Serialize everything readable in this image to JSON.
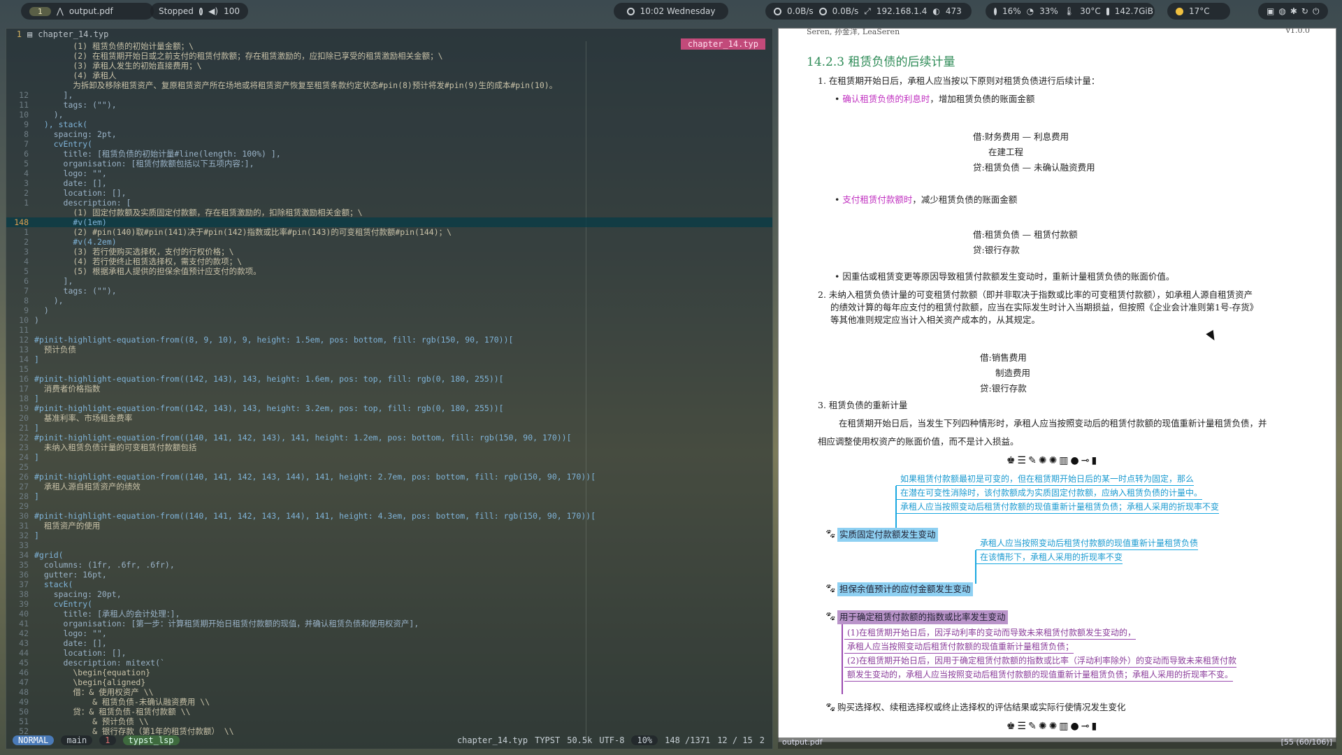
{
  "topbar": {
    "workspace": "1",
    "window_title": "output.pdf",
    "player_status": "Stopped",
    "volume": "100",
    "clock": "10:02 Wednesday",
    "net_down": "0.0B/s",
    "net_up": "0.0B/s",
    "ip": "192.168.1.4",
    "count": "473",
    "cpu": "16%",
    "mem": "33%",
    "temp": "30°C",
    "disk": "142.7GiB",
    "weather": "17°C"
  },
  "editor": {
    "filename": "chapter_14.typ",
    "header_line": "1",
    "tab_label": "chapter_14.typ",
    "lines": [
      {
        "n": "",
        "t": "        (1) 租赁负债的初始计量金额；\\",
        "c": "cmt"
      },
      {
        "n": "",
        "t": "        (2) 在租赁期开始日或之前支付的租赁付款额；存在租赁激励的，应扣除已享受的租赁激励相关金额；\\",
        "c": "cmt"
      },
      {
        "n": "",
        "t": "        (3) 承租人发生的初始直接费用；\\",
        "c": "cmt"
      },
      {
        "n": "",
        "t": "        (4) 承租人",
        "c": "cmt"
      },
      {
        "n": "",
        "t": "        为拆卸及移除租赁资产、复原租赁资产所在场地或将租赁资产恢复至租赁条款约定状态#pin(8)预计将发#pin(9)生的成本#pin(10)。",
        "c": "cmt"
      },
      {
        "n": "12",
        "t": "      ],",
        "c": "key"
      },
      {
        "n": "11",
        "t": "      tags: (\"\"),",
        "c": "key"
      },
      {
        "n": "10",
        "t": "    ),",
        "c": "key"
      },
      {
        "n": "9",
        "t": "  ), stack(",
        "c": "fn"
      },
      {
        "n": "8",
        "t": "    spacing: 2pt,",
        "c": "key"
      },
      {
        "n": "7",
        "t": "    cvEntry(",
        "c": "fn"
      },
      {
        "n": "6",
        "t": "      title: [租赁负债的初始计量#line(length: 100%) ],",
        "c": "key"
      },
      {
        "n": "5",
        "t": "      organisation: [租赁付款额包括以下五项内容：],",
        "c": "key"
      },
      {
        "n": "4",
        "t": "      logo: \"\",",
        "c": "key"
      },
      {
        "n": "3",
        "t": "      date: [],",
        "c": "key"
      },
      {
        "n": "2",
        "t": "      location: [],",
        "c": "key"
      },
      {
        "n": "1",
        "t": "      description: [",
        "c": "key"
      },
      {
        "n": "",
        "t": "        (1) 固定付款额及实质固定付款额，存在租赁激励的，扣除租赁激励相关金额；\\",
        "c": "cmt"
      },
      {
        "n": "148",
        "t": "        #v(1em)",
        "c": "fn",
        "cur": true
      },
      {
        "n": "1",
        "t": "        (2) #pin(140)取#pin(141)决于#pin(142)指数或比率#pin(143)的可变租赁付款额#pin(144)；\\",
        "c": "cmt"
      },
      {
        "n": "2",
        "t": "        #v(4.2em)",
        "c": "fn"
      },
      {
        "n": "3",
        "t": "        (3) 若行使购买选择权，支付的行权价格；\\",
        "c": "cmt"
      },
      {
        "n": "4",
        "t": "        (4) 若行使终止租赁选择权，需支付的款项；\\",
        "c": "cmt"
      },
      {
        "n": "5",
        "t": "        (5) 根据承租人提供的担保余值预计应支付的款项。",
        "c": "cmt"
      },
      {
        "n": "6",
        "t": "      ],",
        "c": "key"
      },
      {
        "n": "7",
        "t": "      tags: (\"\"),",
        "c": "key"
      },
      {
        "n": "8",
        "t": "    ),",
        "c": "key"
      },
      {
        "n": "9",
        "t": "  )",
        "c": "key"
      },
      {
        "n": "10",
        "t": ")",
        "c": "key"
      },
      {
        "n": "11",
        "t": "",
        "c": "key"
      },
      {
        "n": "12",
        "t": "#pinit-highlight-equation-from((8, 9, 10), 9, height: 1.5em, pos: bottom, fill: rgb(150, 90, 170))[",
        "c": "hl"
      },
      {
        "n": "13",
        "t": "  预计负债",
        "c": "cmt"
      },
      {
        "n": "14",
        "t": "]",
        "c": "hl"
      },
      {
        "n": "15",
        "t": "",
        "c": "key"
      },
      {
        "n": "16",
        "t": "#pinit-highlight-equation-from((142, 143), 143, height: 1.6em, pos: top, fill: rgb(0, 180, 255))[",
        "c": "hl"
      },
      {
        "n": "17",
        "t": "  消费者价格指数",
        "c": "cmt"
      },
      {
        "n": "18",
        "t": "]",
        "c": "hl"
      },
      {
        "n": "19",
        "t": "#pinit-highlight-equation-from((142, 143), 143, height: 3.2em, pos: top, fill: rgb(0, 180, 255))[",
        "c": "hl"
      },
      {
        "n": "20",
        "t": "  基准利率、市场租金费率",
        "c": "cmt"
      },
      {
        "n": "21",
        "t": "]",
        "c": "hl"
      },
      {
        "n": "22",
        "t": "#pinit-highlight-equation-from((140, 141, 142, 143), 141, height: 1.2em, pos: bottom, fill: rgb(150, 90, 170))[",
        "c": "hl"
      },
      {
        "n": "23",
        "t": "  未纳入租赁负债计量的可变租赁付款额包括",
        "c": "cmt"
      },
      {
        "n": "24",
        "t": "]",
        "c": "hl"
      },
      {
        "n": "25",
        "t": "",
        "c": "key"
      },
      {
        "n": "26",
        "t": "#pinit-highlight-equation-from((140, 141, 142, 143, 144), 141, height: 2.7em, pos: bottom, fill: rgb(150, 90, 170))[",
        "c": "hl"
      },
      {
        "n": "27",
        "t": "  承租人源自租赁资产的绩效",
        "c": "cmt"
      },
      {
        "n": "28",
        "t": "]",
        "c": "hl"
      },
      {
        "n": "29",
        "t": "",
        "c": "key"
      },
      {
        "n": "30",
        "t": "#pinit-highlight-equation-from((140, 141, 142, 143, 144), 141, height: 4.3em, pos: bottom, fill: rgb(150, 90, 170))[",
        "c": "hl"
      },
      {
        "n": "31",
        "t": "  租赁资产的使用",
        "c": "cmt"
      },
      {
        "n": "32",
        "t": "]",
        "c": "hl"
      },
      {
        "n": "33",
        "t": "",
        "c": "key"
      },
      {
        "n": "34",
        "t": "#grid(",
        "c": "fn"
      },
      {
        "n": "35",
        "t": "  columns: (1fr, .6fr, .6fr),",
        "c": "key"
      },
      {
        "n": "36",
        "t": "  gutter: 16pt,",
        "c": "key"
      },
      {
        "n": "37",
        "t": "  stack(",
        "c": "fn"
      },
      {
        "n": "38",
        "t": "    spacing: 20pt,",
        "c": "key"
      },
      {
        "n": "39",
        "t": "    cvEntry(",
        "c": "fn"
      },
      {
        "n": "40",
        "t": "      title: [承租人的会计处理：],",
        "c": "key"
      },
      {
        "n": "41",
        "t": "      organisation: [第一步：计算租赁期开始日租赁付款额的现值，并确认租赁负债和使用权资产],",
        "c": "key"
      },
      {
        "n": "42",
        "t": "      logo: \"\",",
        "c": "key"
      },
      {
        "n": "43",
        "t": "      date: [],",
        "c": "key"
      },
      {
        "n": "44",
        "t": "      location: [],",
        "c": "key"
      },
      {
        "n": "45",
        "t": "      description: mitext(`",
        "c": "key"
      },
      {
        "n": "46",
        "t": "        \\begin{equation}",
        "c": "cmt"
      },
      {
        "n": "47",
        "t": "        \\begin{aligned}",
        "c": "cmt"
      },
      {
        "n": "48",
        "t": "        借：& 使用权资产 \\\\",
        "c": "cmt"
      },
      {
        "n": "49",
        "t": "            & 租赁负债-未确认融资费用 \\\\",
        "c": "cmt"
      },
      {
        "n": "50",
        "t": "        贷：& 租赁负债-租赁付款额 \\\\",
        "c": "cmt"
      },
      {
        "n": "51",
        "t": "            & 预计负债 \\\\",
        "c": "cmt"
      },
      {
        "n": "52",
        "t": "            & 银行存款（第1年的租赁付款额） \\\\",
        "c": "cmt"
      }
    ]
  },
  "statusline": {
    "mode": "NORMAL",
    "branch": "main",
    "errors": "1",
    "lsp": "typst_lsp",
    "file": "chapter_14.typ",
    "filetype": "TYPST",
    "size": "50.5k",
    "encoding": "UTF-8",
    "percent": "10%",
    "position": "148 /1371",
    "column": "12 / 15",
    "buffers": "2"
  },
  "pdf": {
    "author": "Seren, 孙金洋, LeaSeren",
    "version": "v1.0.0",
    "section_title": "14.2.3 租赁负债的后续计量",
    "p1": "1.  在租赁期开始日后，承租人应当按以下原则对租赁负债进行后续计量：",
    "b1_hl": "确认租赁负债的利息时",
    "b1_rest": "，增加租赁负债的账面金额",
    "j1a": "借:财务费用 — 利息费用",
    "j1b": "在建工程",
    "j1c": "贷:租赁负债 — 未确认融资费用",
    "b2_hl": "支付租赁付款额时",
    "b2_rest": "，减少租赁负债的账面金额",
    "j2a": "借:租赁负债 — 租赁付款额",
    "j2b": "贷:银行存款",
    "b3": "因重估或租赁变更等原因导致租赁付款额发生变动时，重新计量租赁负债的账面价值。",
    "p2a": "2.  未纳入租赁负债计量的可变租赁付款额（即并非取决于指数或比率的可变租赁付款额），如承租人源自租赁资产",
    "p2b": "的绩效计算的每年应支付的租赁付款额，应当在实际发生时计入当期损益，但按照《企业会计准则第1号-存货》",
    "p2c": "等其他准则规定应当计入相关资产成本的，从其规定。",
    "j3a": "借:销售费用",
    "j3b": "制造费用",
    "j3c": "贷:银行存款",
    "p3": "3. 租赁负债的重新计量",
    "p3body_a": "在租赁期开始日后，当发生下列四种情形时，承租人应当按照变动后的租赁付款额的现值重新计量租赁负债，并",
    "p3body_b": "相应调整使用权资产的账面价值，而不是计入损益。",
    "divider": "♚☰✎✺✺▥●⊸▮",
    "blue1": "如果租赁付款额最初是可变的，但在租赁期开始日后的某一时点转为固定，那么",
    "blue2": "在潜在可变性消除时，该付款额成为实质固定付款额，应纳入租赁负债的计量中。",
    "blue3": "承租人应当按照变动后租赁付款额的现值重新计量租赁负债；承租人采用的折现率不变",
    "tag1": "实质固定付款额发生变动",
    "blue4": "承租人应当按照变动后租赁付款额的现值重新计量租赁负债",
    "blue5": "在该情形下，承租人采用的折现率不变",
    "tag2": "担保余值预计的应付金额发生变动",
    "tag3": "用于确定租赁付款额的指数或比率发生变动",
    "pur1": "(1)在租赁期开始日后，因浮动利率的变动而导致未来租赁付款额发生变动的，",
    "pur2": "承租人应当按照变动后租赁付款额的现值重新计量租赁负债；",
    "pur3": "(2)在租赁期开始日后，因用于确定租赁付款额的指数或比率（浮动利率除外）的变动而导致未来租赁付款",
    "pur4": "额发生变动的，承租人应当按照变动后租赁付款额的现值重新计量租赁负债；承租人采用的折现率不变。",
    "tag4": "购买选择权、续租选择权或终止选择权的评估结果或实际行使情况发生变化",
    "footer_left": "output.pdf",
    "footer_right": "[55 (60/106)]"
  },
  "colors": {
    "accent_green": "#2e8b57",
    "magenta": "#c030c0",
    "highlight_blue": "#8ed0f2",
    "highlight_purple": "#b994c9"
  }
}
